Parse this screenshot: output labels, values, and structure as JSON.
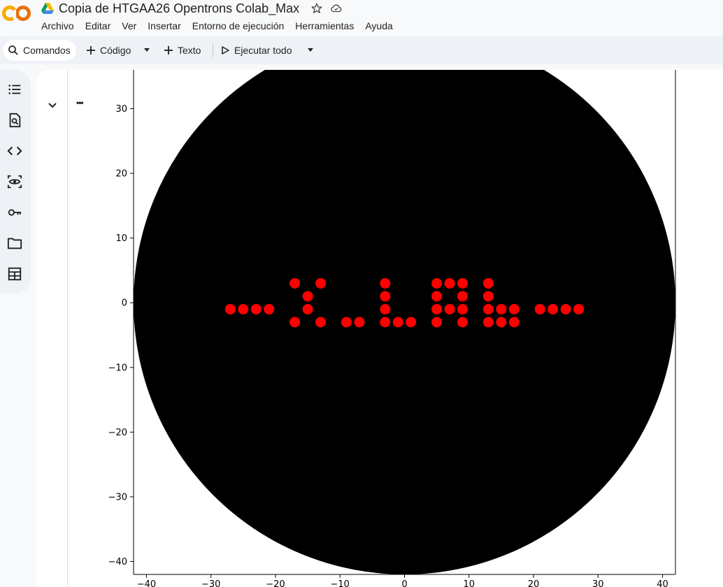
{
  "app": {
    "title": "Copia de HTGAA26 Opentrons Colab_Max",
    "logo_text": "CO"
  },
  "menu": [
    "Archivo",
    "Editar",
    "Ver",
    "Insertar",
    "Entorno de ejecución",
    "Herramientas",
    "Ayuda"
  ],
  "toolbar": {
    "commands": "Comandos",
    "code": "Código",
    "text": "Texto",
    "run_all": "Ejecutar todo"
  },
  "sidebar_icons": [
    "table-of-contents-icon",
    "find-replace-icon",
    "code-snippets-icon",
    "variables-icon",
    "secrets-key-icon",
    "files-folder-icon",
    "data-table-icon"
  ],
  "cell": {
    "output_menu": "•••"
  },
  "colors": {
    "background": "#000000",
    "points": "#ff0000",
    "accent_orange": "#f9ab00"
  },
  "chart_data": {
    "type": "scatter",
    "title": "",
    "xlabel": "",
    "ylabel": "",
    "xlim": [
      -42,
      42
    ],
    "ylim": [
      -42,
      36
    ],
    "x_ticks": [
      -40,
      -30,
      -20,
      -10,
      0,
      10,
      20,
      30,
      40
    ],
    "y_ticks": [
      -40,
      -30,
      -20,
      -10,
      0,
      10,
      20,
      30
    ],
    "circle": {
      "center": [
        0,
        0
      ],
      "radius": 42,
      "color": "#000000"
    },
    "points": [
      [
        -27,
        -1
      ],
      [
        -25,
        -1
      ],
      [
        -23,
        -1
      ],
      [
        -21,
        -1
      ],
      [
        -17,
        3
      ],
      [
        -13,
        3
      ],
      [
        -15,
        1
      ],
      [
        -15,
        -1
      ],
      [
        -17,
        -3
      ],
      [
        -13,
        -3
      ],
      [
        -9,
        -3
      ],
      [
        -7,
        -3
      ],
      [
        -3,
        3
      ],
      [
        -3,
        1
      ],
      [
        -3,
        -1
      ],
      [
        -3,
        -3
      ],
      [
        -1,
        -3
      ],
      [
        1,
        -3
      ],
      [
        5,
        3
      ],
      [
        7,
        3
      ],
      [
        9,
        3
      ],
      [
        5,
        1
      ],
      [
        9,
        1
      ],
      [
        5,
        -1
      ],
      [
        7,
        -1
      ],
      [
        9,
        -1
      ],
      [
        5,
        -3
      ],
      [
        9,
        -3
      ],
      [
        13,
        3
      ],
      [
        13,
        1
      ],
      [
        13,
        -1
      ],
      [
        15,
        -1
      ],
      [
        17,
        -1
      ],
      [
        13,
        -3
      ],
      [
        15,
        -3
      ],
      [
        17,
        -3
      ],
      [
        21,
        -1
      ],
      [
        23,
        -1
      ],
      [
        25,
        -1
      ],
      [
        27,
        -1
      ]
    ],
    "point_color": "#ff0000"
  }
}
